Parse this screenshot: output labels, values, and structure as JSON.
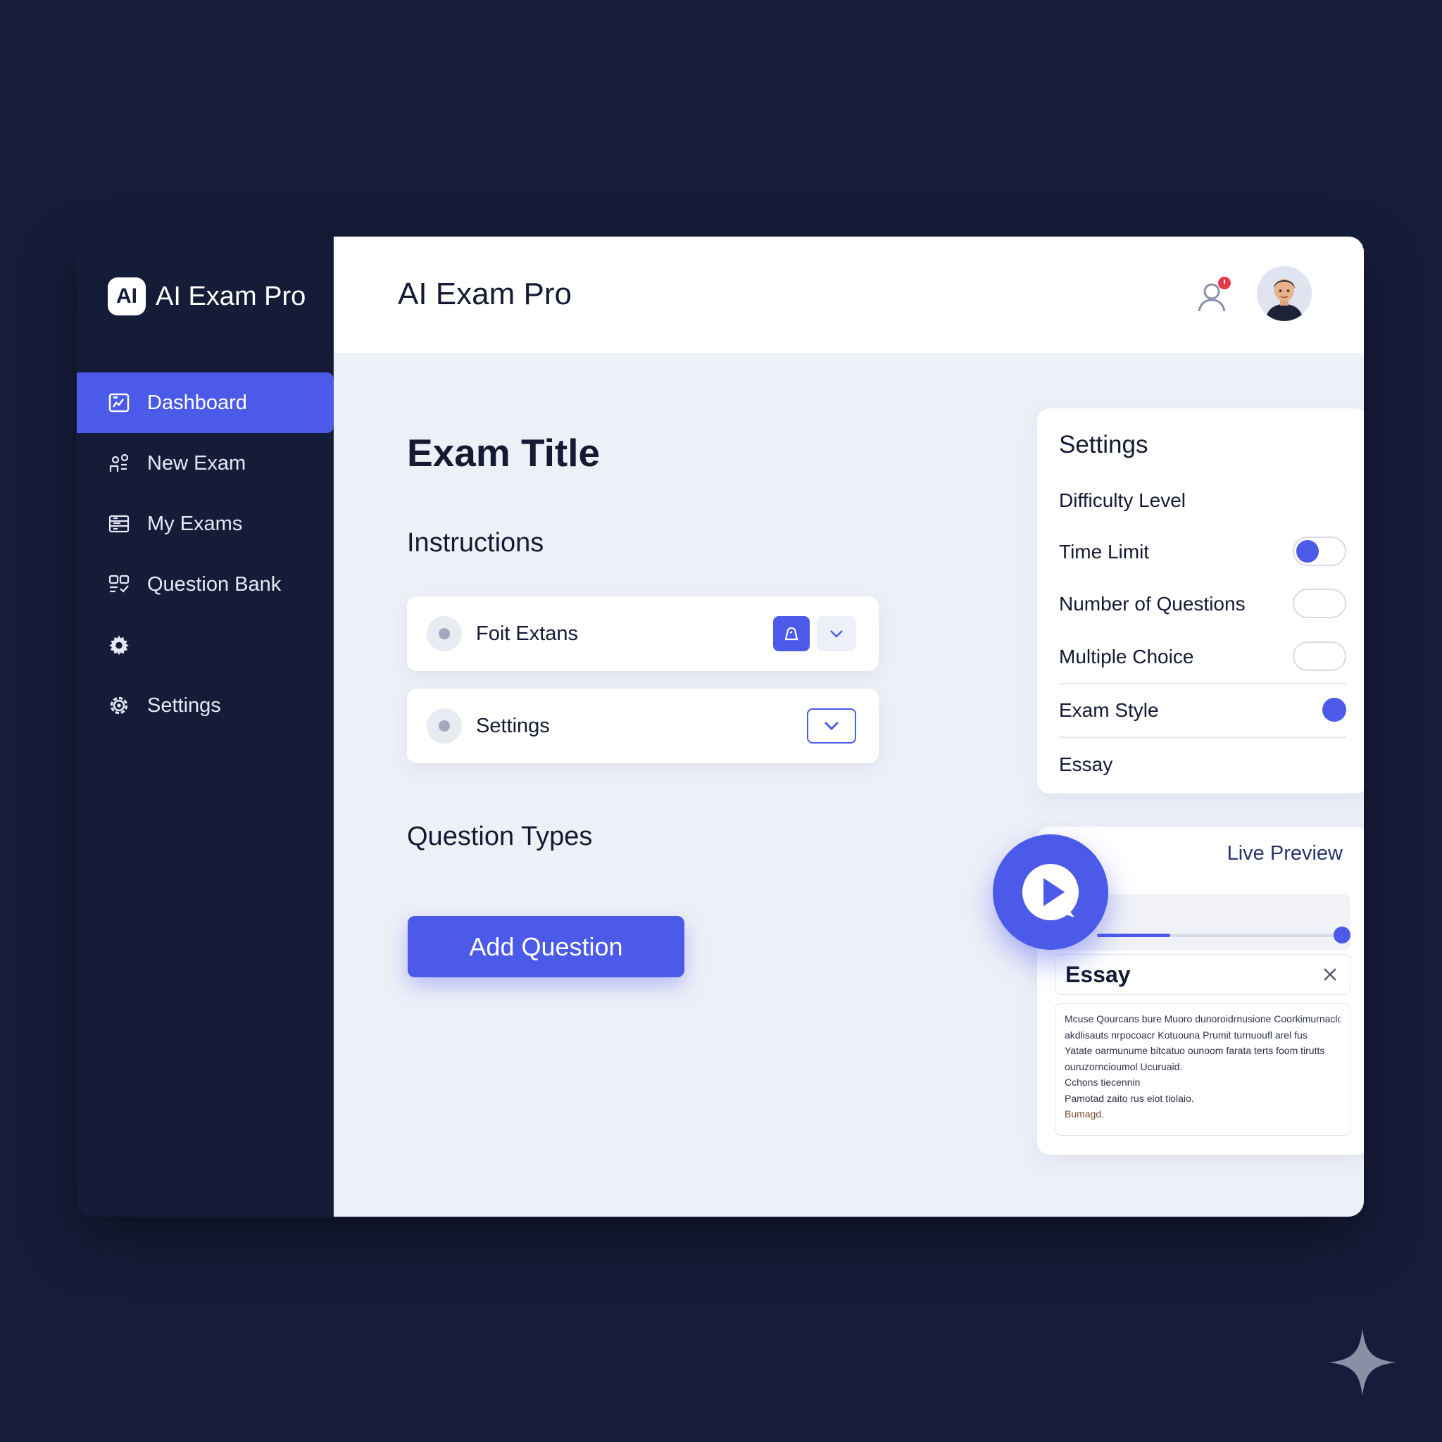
{
  "app": {
    "brand_badge": "AI",
    "brand_name": "AI Exam Pro"
  },
  "sidebar": {
    "items": [
      {
        "label": "Dashboard",
        "icon": "dashboard-icon",
        "active": true
      },
      {
        "label": "New Exam",
        "icon": "new-exam-icon",
        "active": false
      },
      {
        "label": "My Exams",
        "icon": "my-exams-icon",
        "active": false
      },
      {
        "label": "Question Bank",
        "icon": "question-bank-icon",
        "active": false
      },
      {
        "label": "",
        "icon": "gear-icon",
        "active": false
      },
      {
        "label": "Settings",
        "icon": "gear-icon",
        "active": false
      }
    ]
  },
  "header": {
    "title": "AI Exam Pro",
    "notification_icon": "user-notification-icon",
    "avatar_icon": "avatar"
  },
  "main": {
    "exam_title": "Exam Title",
    "instructions_label": "Instructions",
    "instruction_cards": [
      {
        "label": "Foit Extans"
      },
      {
        "label": "Settings"
      }
    ],
    "question_types_label": "Question Types",
    "add_question_label": "Add Question"
  },
  "settings_panel": {
    "title": "Settings",
    "rows": [
      {
        "label": "Difficulty Level",
        "control": "none"
      },
      {
        "label": "Time Limit",
        "control": "toggle",
        "on": true
      },
      {
        "label": "Number of Questions",
        "control": "toggle",
        "on": false
      },
      {
        "label": "Multiple Choice",
        "control": "toggle",
        "on": false
      },
      {
        "label": "Exam Style",
        "control": "dot",
        "on": true
      },
      {
        "label": "Essay",
        "control": "none"
      }
    ]
  },
  "preview": {
    "title": "Live Preview",
    "progress": 0.3,
    "essay_title": "Essay",
    "essay_lines": [
      "Mcuse Qourcans bure Muoro dunoroidrnusione Coorkimurnacloe",
      "akdlisauts nrpocoacr Kotuouna Prumit turnuoufl arel fus",
      "Yatate oarmunume bitcatuo ounoom farata terts foom tirutts",
      "ouruzorncioumol Ucuruaid.",
      "Cchons tiecennin",
      "Pamotad zaito rus eiot tiolaio.",
      "Bumagd."
    ]
  },
  "colors": {
    "accent": "#4b5ae8",
    "page_bg": "#161d3a",
    "sidebar_bg": "#151c38",
    "main_bg": "#eef0f8",
    "notification_dot": "#e8394a"
  }
}
